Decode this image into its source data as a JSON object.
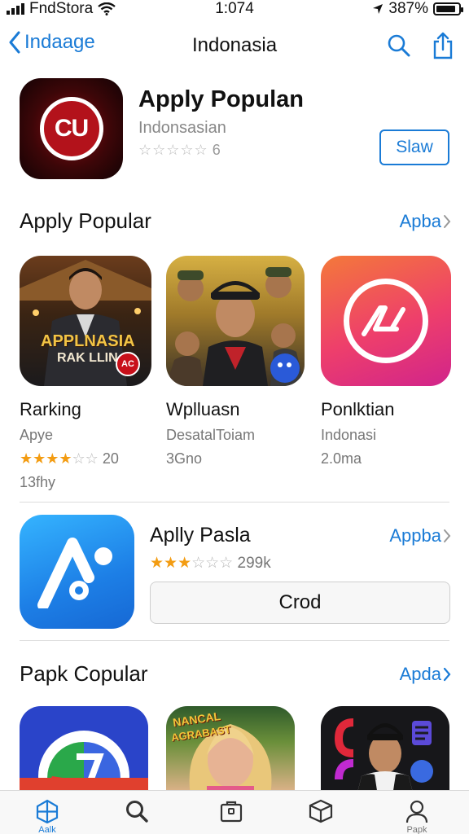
{
  "status_bar": {
    "carrier": "FndStora",
    "time": "1:074",
    "battery": "387%",
    "battery_level": 0.87
  },
  "nav": {
    "back_label": "Indaage",
    "title": "Indonasia"
  },
  "featured": {
    "icon_text": "CU",
    "name": "Apply Populan",
    "subtitle": "Indonsasian",
    "stars": "☆☆☆☆☆",
    "rating_count": "6",
    "button_label": "Slaw"
  },
  "section1": {
    "heading": "Apply Popular",
    "see_all": "Apba"
  },
  "cards": [
    {
      "thumb_caption_line1": "APPLNASIA",
      "thumb_caption_line2": "RAK LLIN",
      "badge": "AC",
      "title": "Rarking",
      "subtitle": "Apye",
      "rating": 3.5,
      "rating_count": "20",
      "extra": "13fhy"
    },
    {
      "title": "Wplluasn",
      "subtitle": "DesatalToiam",
      "meta": "3Gno"
    },
    {
      "icon_glyph": "AC",
      "title": "Ponlktian",
      "subtitle": "Indonasi",
      "meta": "2.0ma"
    }
  ],
  "list_app": {
    "name": "Aplly Pasla",
    "see_all": "Appba",
    "rating": 3,
    "rating_count": "299k",
    "button_label": "Crod"
  },
  "section2": {
    "heading": "Papk Copular",
    "see_all": "Apda"
  },
  "bottom_thumbs": [
    {
      "kind": "logo-icon"
    },
    {
      "caption_line1": "NANCAL",
      "caption_line2": "AGRABAST"
    },
    {
      "kind": "person-apps"
    }
  ],
  "tabs": [
    {
      "label": "Aalk",
      "icon": "grid-icon",
      "active": true
    },
    {
      "label": "",
      "icon": "search-icon",
      "active": false
    },
    {
      "label": "",
      "icon": "bag-icon",
      "active": false
    },
    {
      "label": "",
      "icon": "box-icon",
      "active": false
    },
    {
      "label": "Papk",
      "icon": "person-icon",
      "active": false
    }
  ],
  "colors": {
    "accent": "#1a7bd6",
    "star": "#f39c12"
  }
}
